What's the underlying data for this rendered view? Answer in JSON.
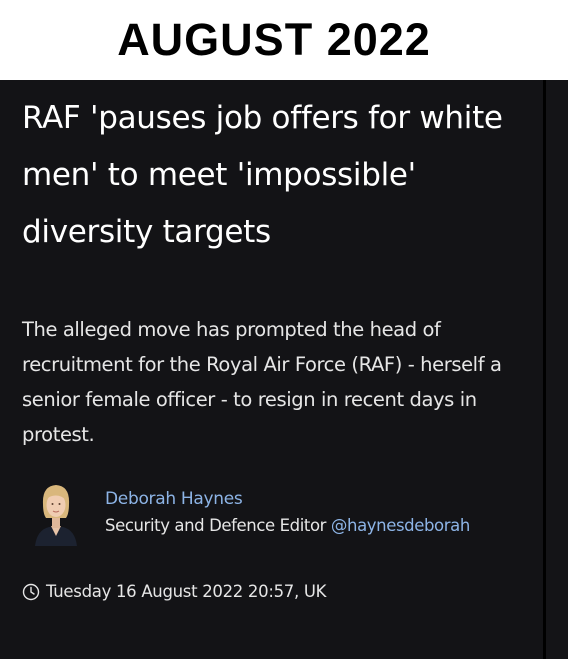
{
  "banner": {
    "title": "AUGUST 2022"
  },
  "article": {
    "headline": "RAF 'pauses job offers for white men' to meet 'impossible' diversity targets",
    "standfirst": "The alleged move has prompted the head of recruitment for the Royal Air Force (RAF) - herself a senior female officer - to resign in recent days in protest.",
    "author": {
      "name": "Deborah Haynes",
      "role": "Security and Defence Editor",
      "handle": "@haynesdeborah",
      "avatar_icon": "author-photo"
    },
    "timestamp": "Tuesday 16 August 2022 20:57, UK",
    "timestamp_icon": "clock-icon"
  },
  "colors": {
    "background": "#131316",
    "text": "#ffffff",
    "link": "#8db4e6",
    "banner_bg": "#ffffff"
  }
}
